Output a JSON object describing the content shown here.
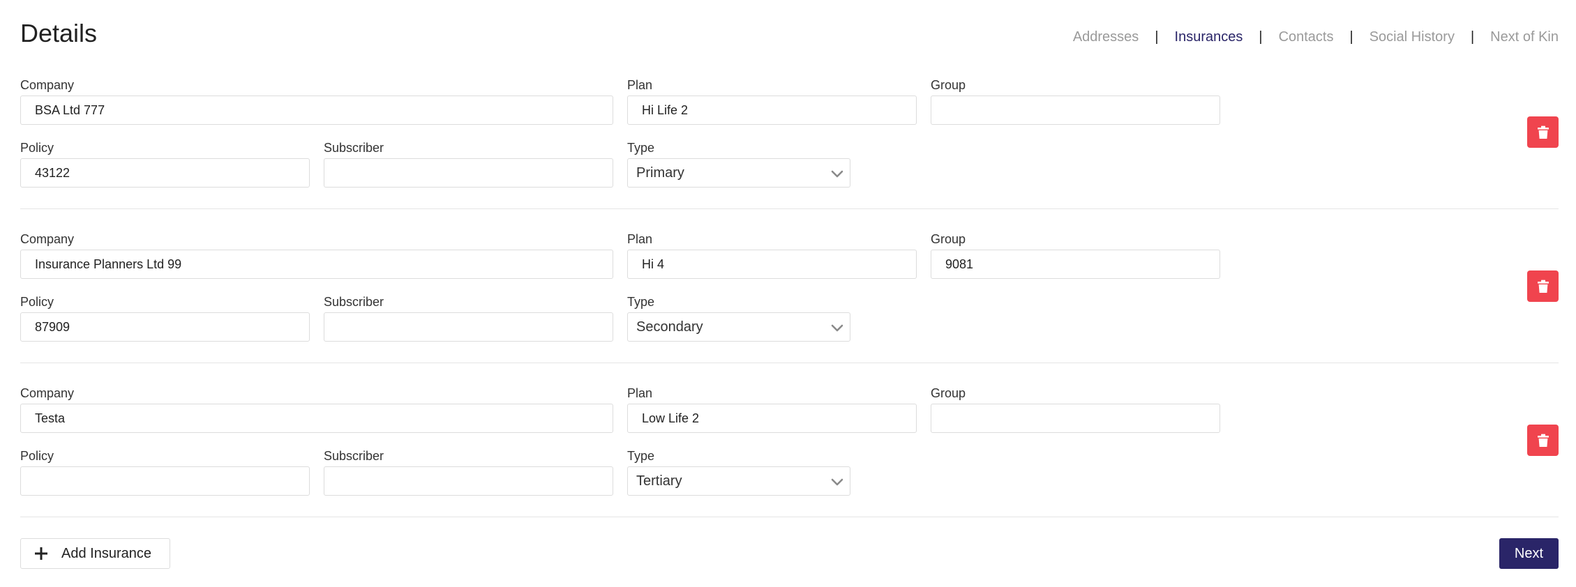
{
  "header": {
    "title": "Details"
  },
  "tabs": [
    {
      "label": "Addresses",
      "active": false
    },
    {
      "label": "Insurances",
      "active": true
    },
    {
      "label": "Contacts",
      "active": false
    },
    {
      "label": "Social History",
      "active": false
    },
    {
      "label": "Next of Kin",
      "active": false
    }
  ],
  "tab_separator": "|",
  "labels": {
    "company": "Company",
    "plan": "Plan",
    "group": "Group",
    "policy": "Policy",
    "subscriber": "Subscriber",
    "type": "Type"
  },
  "insurances": [
    {
      "company": "BSA Ltd 777",
      "plan": "Hi Life 2",
      "group": "",
      "policy": "43122",
      "subscriber": "",
      "type": "Primary"
    },
    {
      "company": "Insurance Planners Ltd 99",
      "plan": "Hi 4",
      "group": "9081",
      "policy": "87909",
      "subscriber": "",
      "type": "Secondary"
    },
    {
      "company": "Testa",
      "plan": "Low Life 2",
      "group": "",
      "policy": "",
      "subscriber": "",
      "type": "Tertiary"
    }
  ],
  "actions": {
    "add_label": "Add Insurance",
    "next_label": "Next"
  },
  "icons": {
    "delete": "trash-icon",
    "add": "plus-icon",
    "select": "chevron-down-icon"
  },
  "colors": {
    "primary": "#2a2568",
    "danger": "#f0444e",
    "muted_tab": "#9a9a9a"
  }
}
